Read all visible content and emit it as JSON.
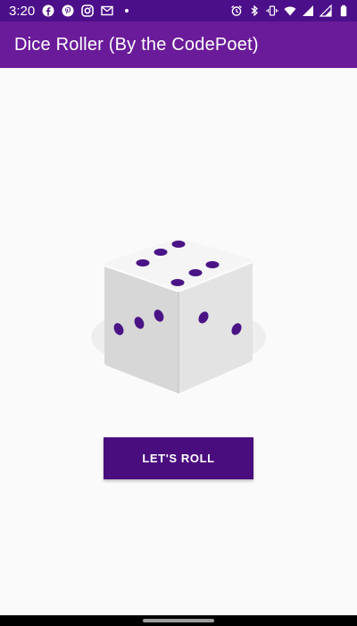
{
  "status_bar": {
    "time": "3:20",
    "left_icons": [
      "facebook-icon",
      "pinterest-icon",
      "instagram-icon",
      "gmail-icon",
      "dot-icon"
    ],
    "right_icons": [
      "alarm-icon",
      "bluetooth-icon",
      "vibrate-icon",
      "wifi-icon",
      "signal-icon",
      "signal-icon",
      "battery-icon"
    ]
  },
  "app_bar": {
    "title": "Dice Roller (By the CodePoet)"
  },
  "dice": {
    "top_face_pips": 6,
    "left_face_pips": 3,
    "right_face_pips": 2,
    "pip_color": "#4a1486"
  },
  "roll_button": {
    "label": "LET'S ROLL"
  },
  "colors": {
    "status_bar": "#4c0f8a",
    "app_bar": "#6a1b9a",
    "button": "#4a0d7e",
    "background": "#fafafa"
  }
}
